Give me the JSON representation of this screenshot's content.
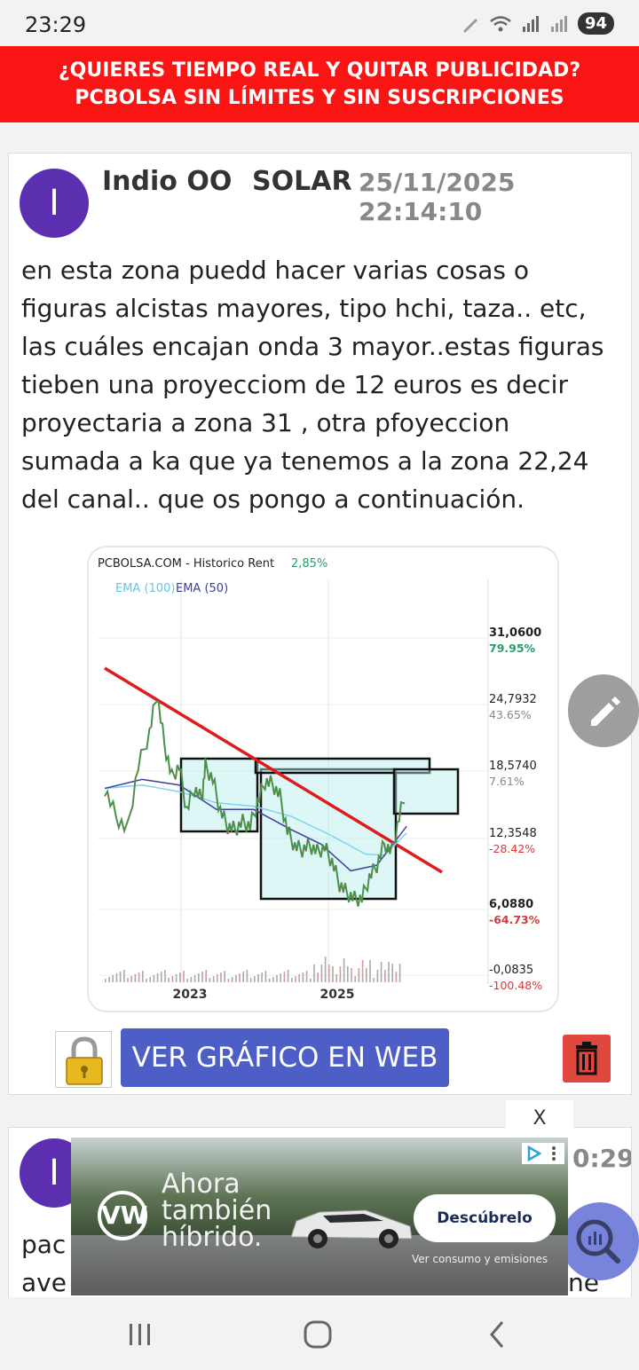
{
  "status_bar": {
    "time": "23:29",
    "battery": "94"
  },
  "promo": {
    "line1": "¿QUIERES TIEMPO REAL Y QUITAR PUBLICIDAD?",
    "line2": "PCBOLSA SIN LÍMITES Y SIN SUSCRIPCIONES"
  },
  "post": {
    "avatar_letter": "I",
    "user": "Indio OO",
    "ticker": "SOLAR",
    "date": "25/11/2025 22:14:10",
    "lines": [
      "en esta zona puedd hacer varias cosas o",
      "figuras alcistas mayores, tipo hchi, taza.. etc,",
      "las cuáles encajan onda 3 mayor..estas figuras",
      "tieben una proyecciom de 12 euros es decir",
      "proyectaria a zona 31 , otra pfoyeccion",
      "sumada a ka que ya tenemos a la zona 22,24",
      "del canal.. que os pongo a continuación."
    ]
  },
  "chart_data": {
    "type": "line",
    "header": "PCBOLSA.COM - Historico  Rent",
    "header_value": "2,85%",
    "legend": [
      "EMA (100)",
      "EMA (50)"
    ],
    "x_tick_labels": [
      "2023",
      "2025"
    ],
    "y_ticks": [
      {
        "price": "31,0600",
        "pct": "79.95%",
        "pct_color": "#2a9d6a"
      },
      {
        "price": "24,7932",
        "pct": "43.65%",
        "pct_color": "#888888"
      },
      {
        "price": "18,5740",
        "pct": "7.61%",
        "pct_color": "#888888"
      },
      {
        "price": "12,3548",
        "pct": "-28.42%",
        "pct_color": "#d23b3b"
      },
      {
        "price": "6,0880",
        "pct": "-64.73%",
        "pct_color": "#d23b3b"
      },
      {
        "price": "-0,0835",
        "pct": "-100.48%",
        "pct_color": "#d23b3b"
      }
    ],
    "price_series": [
      [
        0,
        17
      ],
      [
        3,
        14.5
      ],
      [
        6,
        13.2
      ],
      [
        9,
        19
      ],
      [
        12,
        22
      ],
      [
        14,
        25.5
      ],
      [
        16,
        21
      ],
      [
        18,
        18
      ],
      [
        20,
        19
      ],
      [
        22,
        15
      ],
      [
        24,
        17
      ],
      [
        26,
        16
      ],
      [
        27,
        19
      ],
      [
        29,
        17.8
      ],
      [
        31,
        15
      ],
      [
        33,
        13.6
      ],
      [
        35,
        13.3
      ],
      [
        37,
        14
      ],
      [
        39,
        13.6
      ],
      [
        41,
        15.7
      ],
      [
        43,
        17.6
      ],
      [
        45,
        17.4
      ],
      [
        47,
        16.3
      ],
      [
        49,
        13.2
      ],
      [
        51,
        11.8
      ],
      [
        53,
        11.5
      ],
      [
        55,
        11.9
      ],
      [
        57,
        11.3
      ],
      [
        59,
        11.7
      ],
      [
        61,
        10.4
      ],
      [
        63,
        8.4
      ],
      [
        65,
        7.6
      ],
      [
        67,
        7.1
      ],
      [
        69,
        7.1
      ],
      [
        71,
        9
      ],
      [
        73,
        10.1
      ],
      [
        75,
        12
      ],
      [
        77,
        11.3
      ],
      [
        79,
        14.4
      ],
      [
        81,
        17
      ]
    ],
    "ema100_series": [
      [
        0,
        17
      ],
      [
        10,
        17.3
      ],
      [
        20,
        16.7
      ],
      [
        30,
        15.7
      ],
      [
        40,
        15.4
      ],
      [
        50,
        14.5
      ],
      [
        60,
        12.9
      ],
      [
        70,
        11.1
      ],
      [
        75,
        11
      ],
      [
        81,
        13
      ]
    ],
    "ema50_series": [
      [
        0,
        17
      ],
      [
        10,
        17.8
      ],
      [
        20,
        17.3
      ],
      [
        30,
        15.1
      ],
      [
        40,
        15.1
      ],
      [
        50,
        13.3
      ],
      [
        58,
        12
      ],
      [
        66,
        9.6
      ],
      [
        73,
        10.1
      ],
      [
        81,
        13.6
      ]
    ],
    "volume_bars": "small bars along bottom",
    "drawings": "red descending trendline, light-cyan rectangles drawn by user"
  },
  "actions": {
    "web_button": "VER GRÁFICO EN WEB"
  },
  "post2": {
    "avatar_letter": "I",
    "time_fragment": "0:29",
    "body_fragment1": "pac",
    "body_fragment2": "ave",
    "body_fragment3": "ne"
  },
  "ad": {
    "close": "X",
    "brand": "VW",
    "headline": [
      "Ahora",
      "también",
      "híbrido."
    ],
    "cta": "Descúbrelo",
    "fine_print": "Ver consumo y emisiones"
  }
}
